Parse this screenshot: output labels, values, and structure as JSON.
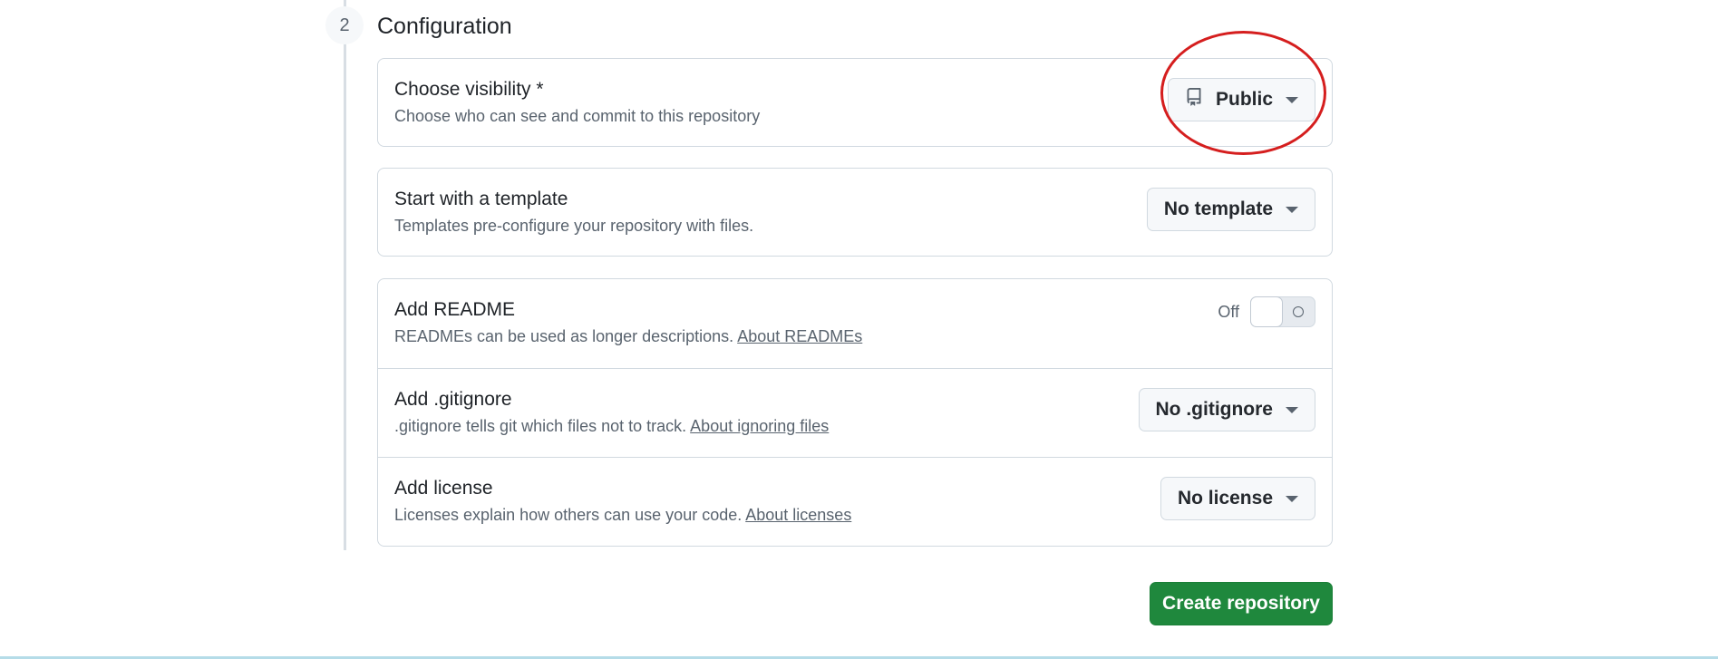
{
  "section": {
    "step_number": "2",
    "title": "Configuration"
  },
  "visibility": {
    "title": "Choose visibility *",
    "description": "Choose who can see and commit to this repository",
    "selected": "Public",
    "icon": "repo-icon"
  },
  "template": {
    "title": "Start with a template",
    "description": "Templates pre-configure your repository with files.",
    "selected": "No template"
  },
  "readme": {
    "title": "Add README",
    "description": "READMEs can be used as longer descriptions.",
    "link": "About READMEs",
    "toggle_label": "Off",
    "toggle_state": false
  },
  "gitignore": {
    "title": "Add .gitignore",
    "description": ".gitignore tells git which files not to track.",
    "link": "About ignoring files",
    "selected": "No .gitignore"
  },
  "license": {
    "title": "Add license",
    "description": "Licenses explain how others can use your code.",
    "link": "About licenses",
    "selected": "No license"
  },
  "actions": {
    "create_label": "Create repository"
  },
  "colors": {
    "primary_button": "#1f883d",
    "annotation": "#d51e1e"
  }
}
